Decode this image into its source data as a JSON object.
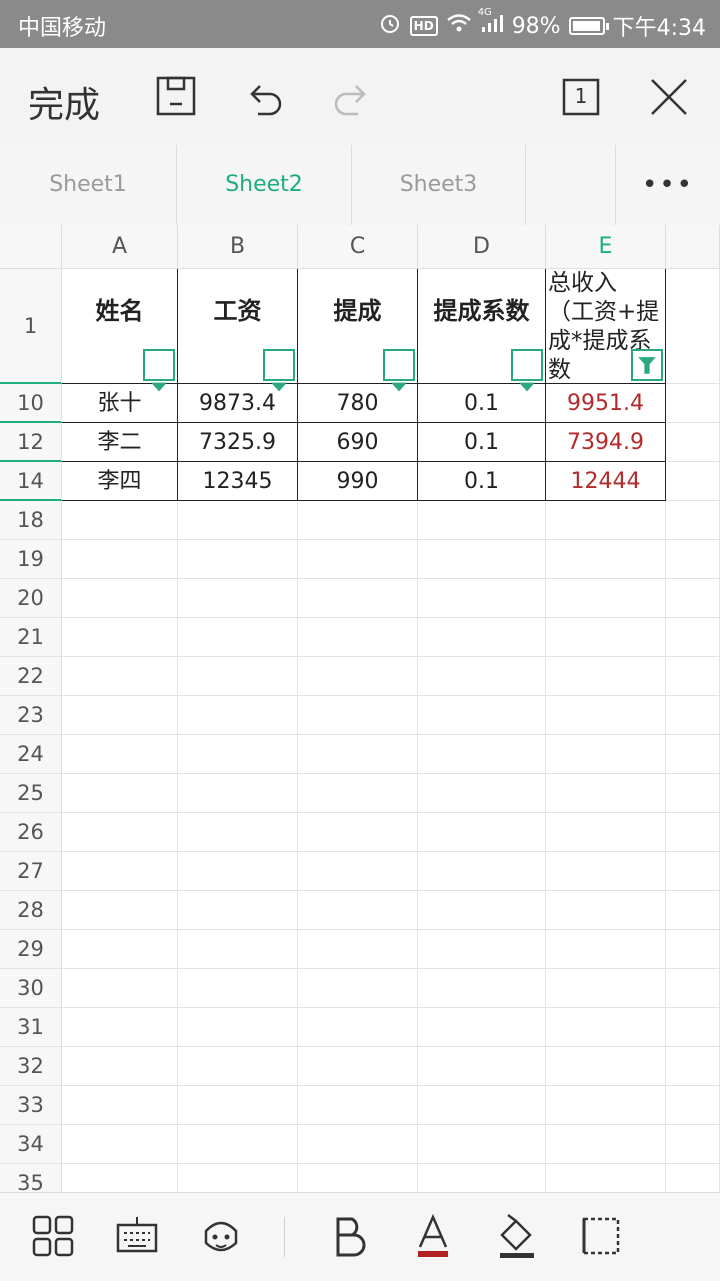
{
  "status_bar": {
    "carrier": "中国移动",
    "network": "4G",
    "battery": "98%",
    "battery_level": 0.98,
    "time": "下午4:34"
  },
  "toolbar": {
    "done_label": "完成",
    "sheet_count": "1"
  },
  "tabs": [
    {
      "label": "Sheet1",
      "active": false
    },
    {
      "label": "Sheet2",
      "active": true
    },
    {
      "label": "Sheet3",
      "active": false
    },
    {
      "label": "",
      "active": false
    },
    {
      "label": "•••",
      "active": false
    }
  ],
  "columns": [
    "A",
    "B",
    "C",
    "D",
    "E"
  ],
  "header_row": {
    "row_label": "1",
    "cells": [
      "姓名",
      "工资",
      "提成",
      "提成系数",
      "总收入（工资+提成*提成系数"
    ]
  },
  "data_rows": [
    {
      "row_label": "10",
      "cells": [
        "张十",
        "9873.4",
        "780",
        "0.1",
        "9951.4"
      ]
    },
    {
      "row_label": "12",
      "cells": [
        "李二",
        "7325.9",
        "690",
        "0.1",
        "7394.9"
      ]
    },
    {
      "row_label": "14",
      "cells": [
        "李四",
        "12345",
        "990",
        "0.1",
        "12444"
      ]
    }
  ],
  "empty_rows": [
    "18",
    "19",
    "20",
    "21",
    "22",
    "23",
    "24",
    "25",
    "26",
    "27",
    "28",
    "29",
    "30",
    "31",
    "32",
    "33",
    "34",
    "35"
  ],
  "colors": {
    "accent": "#1fae7a",
    "result_text": "#b22a2a",
    "status_bar": "#8a8a8a"
  },
  "bottom_tools": [
    "grid-icon",
    "keyboard-icon",
    "smiley-icon",
    "bold-icon",
    "font-color-icon",
    "fill-color-icon",
    "border-icon"
  ]
}
